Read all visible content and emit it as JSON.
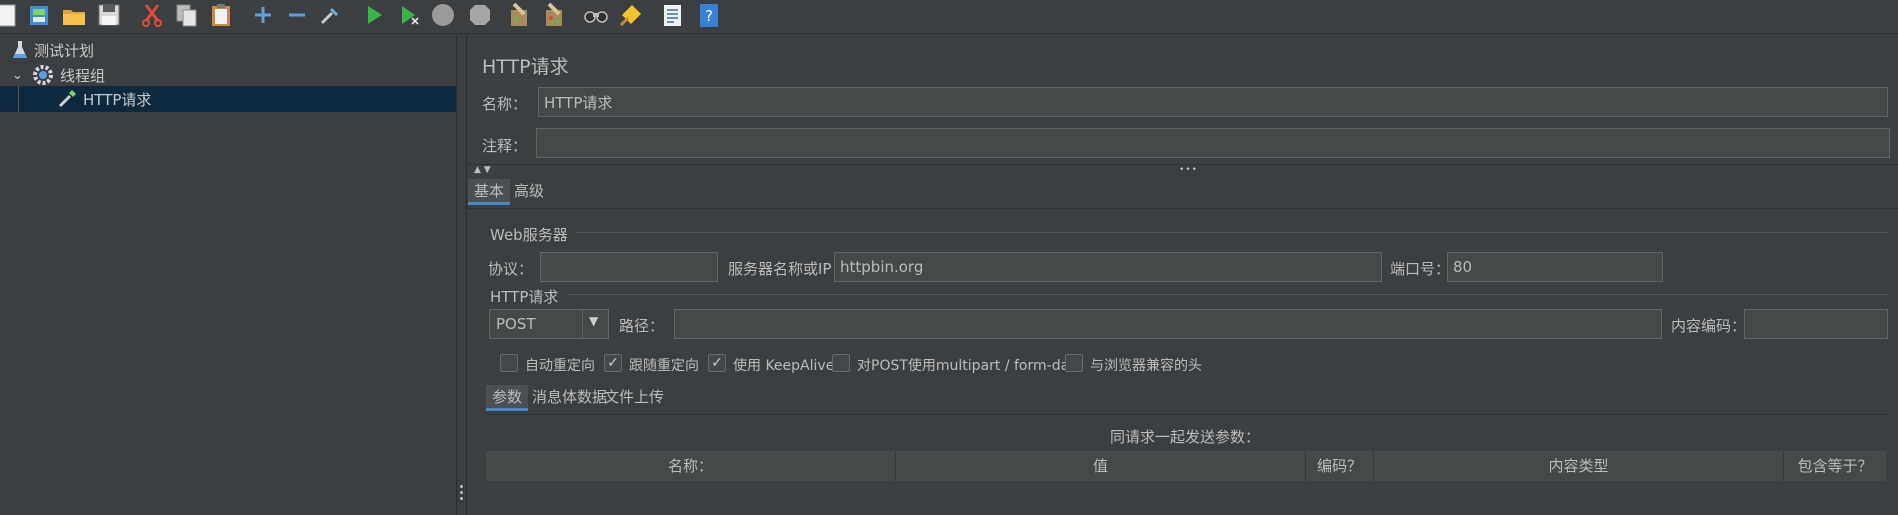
{
  "toolbar": {
    "icons": [
      "new-icon",
      "templates-icon",
      "open-icon",
      "save-icon",
      "cut-icon",
      "copy-icon",
      "paste-icon",
      "expand-icon",
      "collapse-icon",
      "toggle-icon",
      "start-icon",
      "start-no-pause-icon",
      "stop-icon",
      "shutdown-icon",
      "clear-icon",
      "clear-all-icon",
      "search-icon",
      "reset-search-icon",
      "function-helper-icon",
      "help-icon"
    ]
  },
  "tree": {
    "items": [
      {
        "label": "测试计划"
      },
      {
        "label": "线程组"
      },
      {
        "label": "HTTP请求"
      }
    ]
  },
  "panel": {
    "title": "HTTP请求",
    "name_label": "名称：",
    "name_value": "HTTP请求",
    "comment_label": "注释：",
    "comment_value": "",
    "tabs": [
      "基本",
      "高级"
    ],
    "web_server": {
      "legend": "Web服务器",
      "protocol_label": "协议：",
      "protocol_value": "",
      "server_label": "服务器名称或IP：",
      "server_value": "httpbin.org",
      "port_label": "端口号：",
      "port_value": "80"
    },
    "http_request": {
      "legend": "HTTP请求",
      "method": "POST",
      "path_label": "路径：",
      "path_value": "",
      "encoding_label": "内容编码：",
      "encoding_value": ""
    },
    "options": [
      {
        "label": "自动重定向",
        "checked": false
      },
      {
        "label": "跟随重定向",
        "checked": true
      },
      {
        "label": "使用 KeepAlive",
        "checked": true
      },
      {
        "label": "对POST使用multipart / form-data",
        "checked": false
      },
      {
        "label": "与浏览器兼容的头",
        "checked": false
      }
    ],
    "subtabs": [
      "参数",
      "消息体数据",
      "文件上传"
    ],
    "params_caption": "同请求一起发送参数：",
    "table_headers": [
      "名称：",
      "值",
      "编码？",
      "内容类型",
      "包含等于？"
    ]
  },
  "colors": {
    "background": "#3c3f41",
    "field": "#45494a",
    "selection": "#0d293e",
    "accent": "#4a88c7"
  }
}
